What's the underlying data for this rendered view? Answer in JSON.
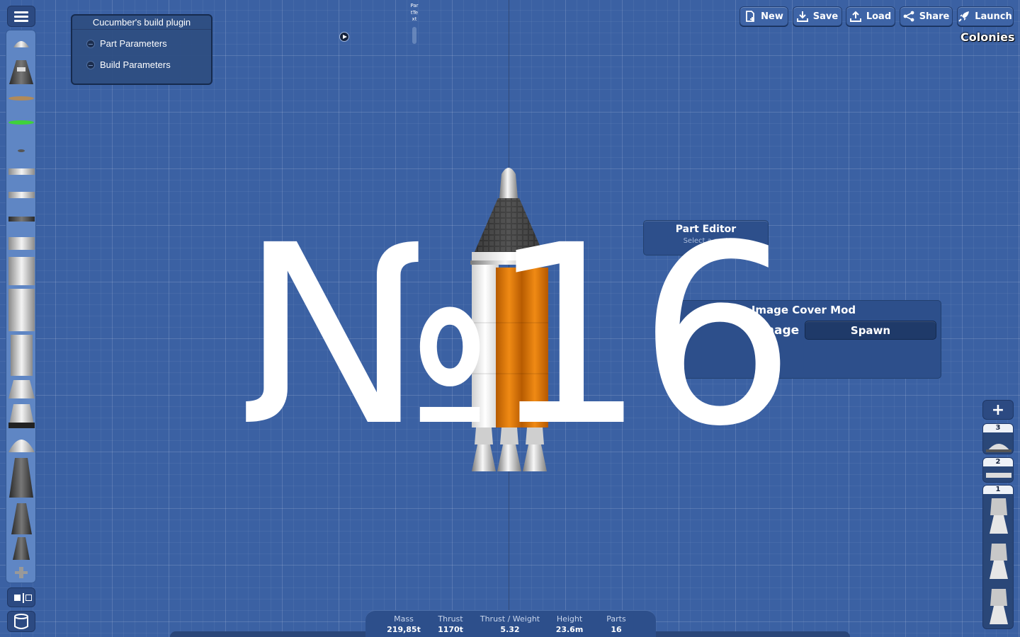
{
  "toolbar": {
    "new_label": "New",
    "save_label": "Save",
    "load_label": "Load",
    "share_label": "Share",
    "launch_label": "Launch"
  },
  "colonies_label": "Colonies",
  "plugin": {
    "title": "Cucumber's build plugin",
    "items": [
      "Part Parameters",
      "Build Parameters"
    ]
  },
  "part_text_label": "PartText",
  "part_editor": {
    "title": "Part Editor",
    "subtitle": "Select a part"
  },
  "image_cover_mod": {
    "title": "Image Cover Mod",
    "label": "Image",
    "spawn_label": "Spawn"
  },
  "overlay_text": "№16",
  "stages": [
    {
      "number": "3",
      "icon": "decoupler-icon"
    },
    {
      "number": "2",
      "icon": "fairing-icon"
    },
    {
      "number": "1",
      "icon": "engine-icon"
    }
  ],
  "stats": {
    "mass_label": "Mass",
    "mass_value": "219,85t",
    "thrust_label": "Thrust",
    "thrust_value": "1170t",
    "tw_label": "Thrust / Weight",
    "tw_value": "5.32",
    "height_label": "Height",
    "height_value": "23.6m",
    "parts_label": "Parts",
    "parts_value": "16"
  },
  "icons": {
    "menu": "hamburger-menu-icon",
    "flip": "flip-icon",
    "trash": "trash-can-icon",
    "add": "plus-icon"
  },
  "colors": {
    "background": "#3b61a3",
    "panel": "#2d4f8b",
    "tank_orange": "#e07a10"
  }
}
